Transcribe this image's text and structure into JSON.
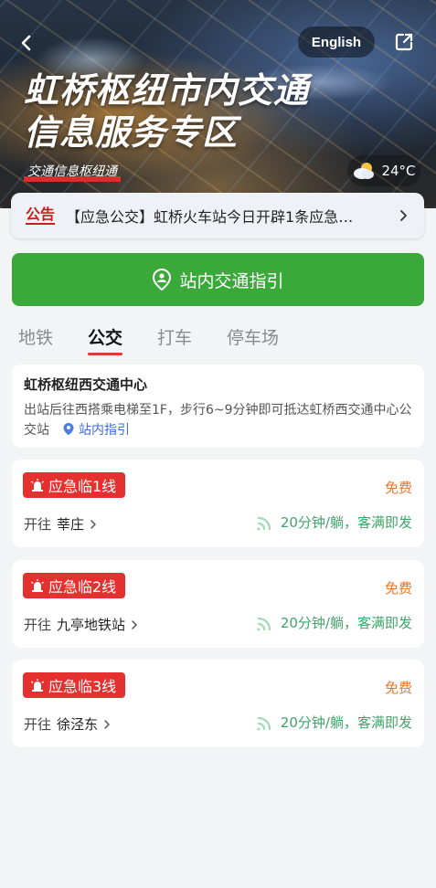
{
  "header": {
    "title_line1": "虹桥枢纽市内交通",
    "title_line2": "信息服务专区",
    "subtitle": "交通信息枢纽通",
    "language_label": "English",
    "weather_temp": "24°C",
    "weather_icon": "partly-cloudy-icon"
  },
  "notice": {
    "tag": "公告",
    "text": "【应急公交】虹桥火车站今日开辟1条应急…"
  },
  "guide_button": {
    "label": "站内交通指引"
  },
  "tabs": [
    {
      "label": "地铁",
      "active": false
    },
    {
      "label": "公交",
      "active": true
    },
    {
      "label": "打车",
      "active": false
    },
    {
      "label": "停车场",
      "active": false
    }
  ],
  "center": {
    "title": "虹桥枢纽西交通中心",
    "desc": "出站后往西搭乘电梯至1F，步行6~9分钟即可抵达虹桥西交通中心公交站",
    "guide_link": "站内指引"
  },
  "routes": [
    {
      "name": "应急临1线",
      "price": "免费",
      "direction": "开往",
      "destination": "莘庄",
      "frequency": "20分钟/躺，客满即发"
    },
    {
      "name": "应急临2线",
      "price": "免费",
      "direction": "开往",
      "destination": "九亭地铁站",
      "frequency": "20分钟/躺，客满即发"
    },
    {
      "name": "应急临3线",
      "price": "免费",
      "direction": "开往",
      "destination": "徐泾东",
      "frequency": "20分钟/躺，客满即发"
    }
  ],
  "colors": {
    "primary_green": "#3aa93a",
    "alert_red": "#e4312f",
    "price_orange": "#e8782c",
    "frequency_green": "#3fa36a"
  }
}
